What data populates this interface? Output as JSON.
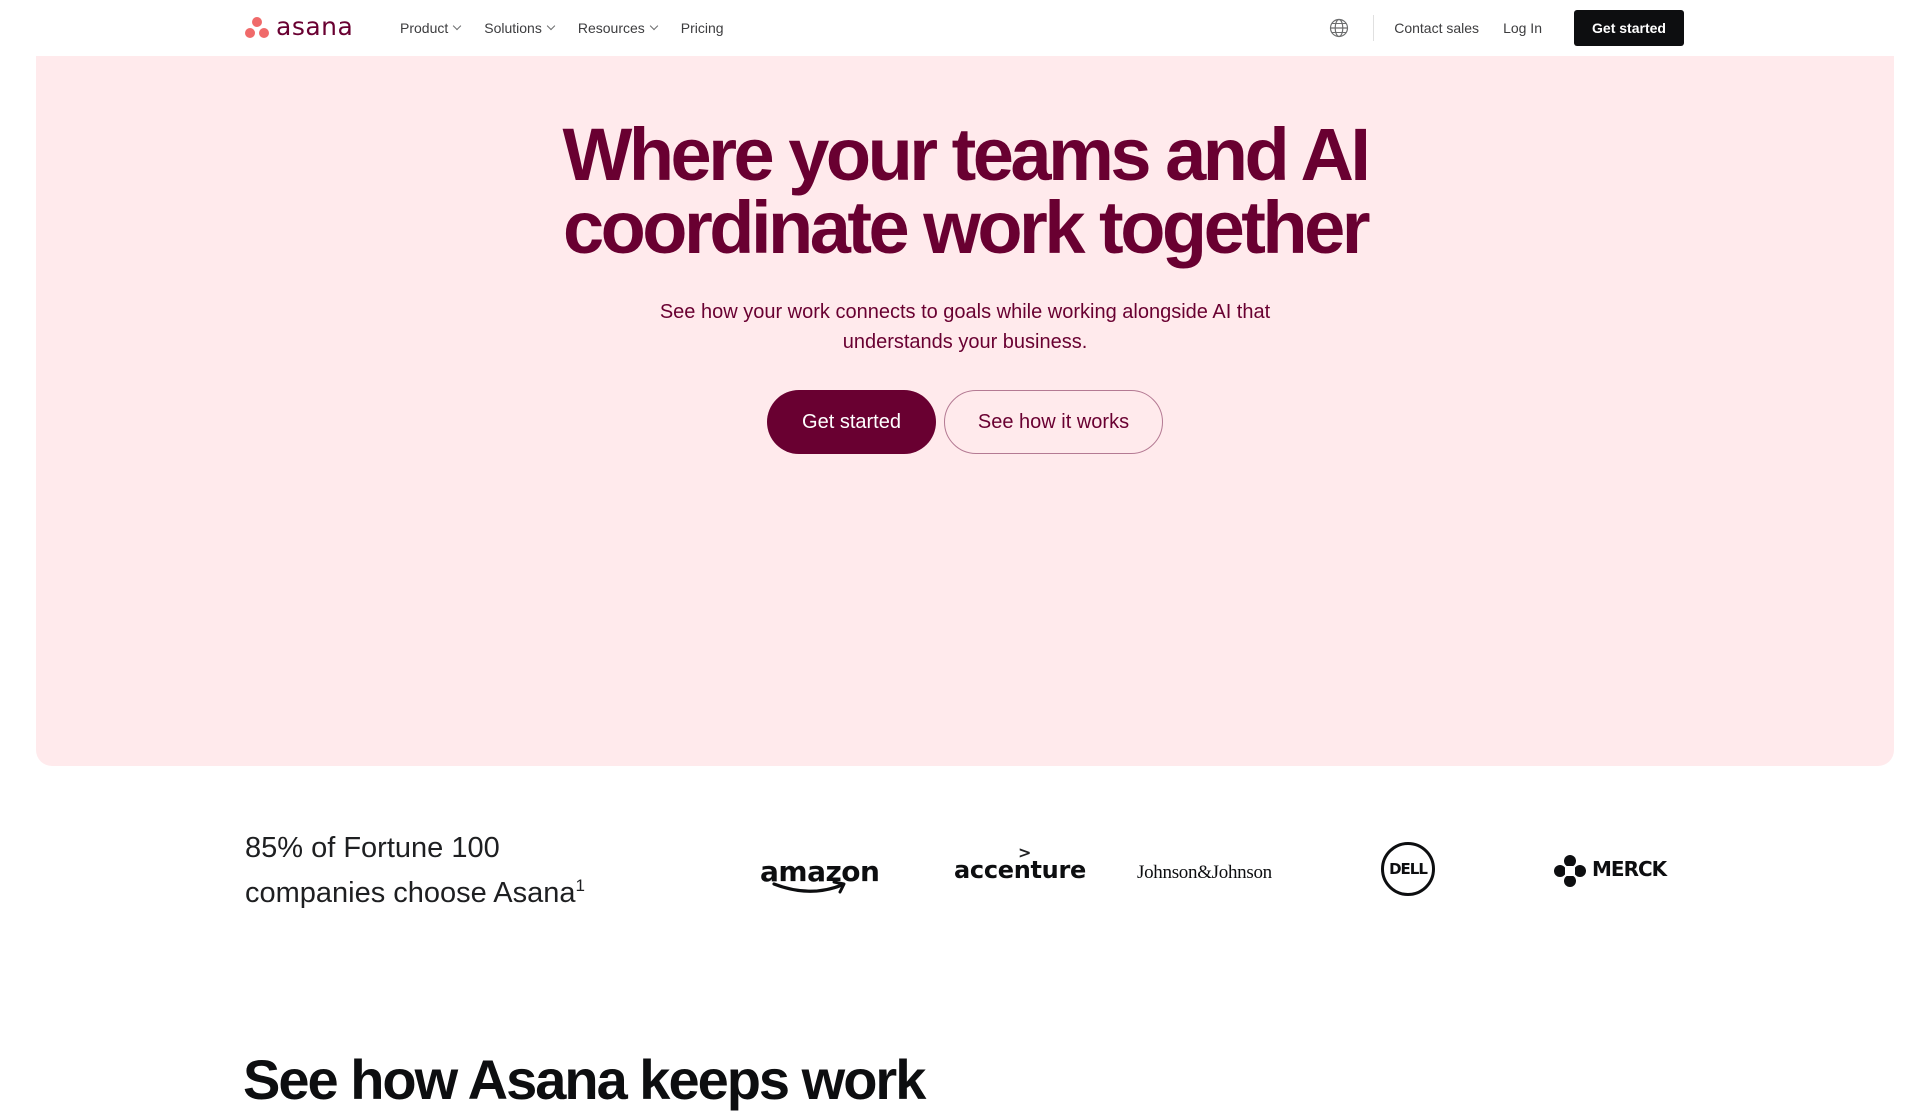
{
  "brand": {
    "logo_text": "asana",
    "logo_color": "#690031",
    "dot_color": "#f06a6a"
  },
  "nav": {
    "items": [
      {
        "label": "Product",
        "has_dropdown": true
      },
      {
        "label": "Solutions",
        "has_dropdown": true
      },
      {
        "label": "Resources",
        "has_dropdown": true
      },
      {
        "label": "Pricing",
        "has_dropdown": false
      }
    ],
    "language_icon": "globe-icon",
    "contact_sales": "Contact sales",
    "log_in": "Log In",
    "get_started": "Get started"
  },
  "hero": {
    "title_line1": "Where your teams and AI",
    "title_line2": "coordinate work together",
    "subtitle_line1": "See how your work connects to goals while working alongside AI that",
    "subtitle_line2": "understands your business.",
    "primary_cta": "Get started",
    "secondary_cta": "See how it works",
    "background_color": "#ffeaec",
    "accent_color": "#690031"
  },
  "customers": {
    "headline_line1": "85% of Fortune 100",
    "headline_line2": "companies choose Asana",
    "footnote": "1",
    "logos": [
      "amazon",
      "accenture",
      "Johnson&Johnson",
      "DELL",
      "MERCK"
    ]
  },
  "next_section": {
    "heading": "See how Asana keeps work"
  }
}
